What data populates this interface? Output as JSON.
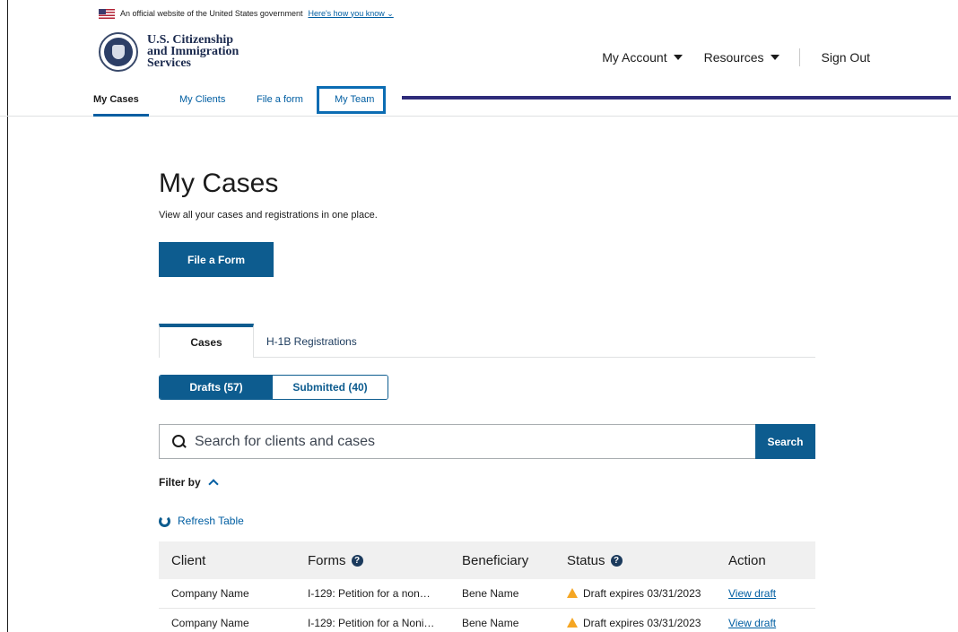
{
  "banner": {
    "text": "An official website of the United States government",
    "link": "Here's how you know ⌄"
  },
  "header": {
    "agency_line1": "U.S. Citizenship",
    "agency_line2": "and Immigration",
    "agency_line3": "Services",
    "nav": {
      "my_account": "My Account",
      "resources": "Resources",
      "sign_out": "Sign Out"
    }
  },
  "subnav": {
    "tabs": [
      "My Cases",
      "My Clients",
      "File a form",
      "My Team"
    ]
  },
  "main": {
    "title": "My Cases",
    "subtitle": "View all your cases and registrations in one place.",
    "file_form_button": "File a Form",
    "tabs": [
      "Cases",
      "H-1B Registrations"
    ],
    "toggle": [
      "Drafts (57)",
      "Submitted (40)"
    ],
    "search": {
      "placeholder": "Search for clients and cases",
      "button": "Search"
    },
    "filter_label": "Filter by",
    "refresh_label": "Refresh Table",
    "table": {
      "headers": [
        "Client",
        "Forms",
        "Beneficiary",
        "Status",
        "Action"
      ],
      "rows": [
        {
          "client": "Company Name",
          "form": "I-129: Petition for a non…",
          "beneficiary": "Bene Name",
          "status": "Draft expires 03/31/2023",
          "action": "View draft"
        },
        {
          "client": "Company Name",
          "form": "I-129: Petition for a Noni…",
          "beneficiary": "Bene Name",
          "status": "Draft expires 03/31/2023",
          "action": "View draft"
        }
      ]
    }
  },
  "colors": {
    "primary": "#0d5c8f",
    "link": "#005ea2",
    "warning": "#f5a623",
    "annotation": "#2e2b7a"
  }
}
